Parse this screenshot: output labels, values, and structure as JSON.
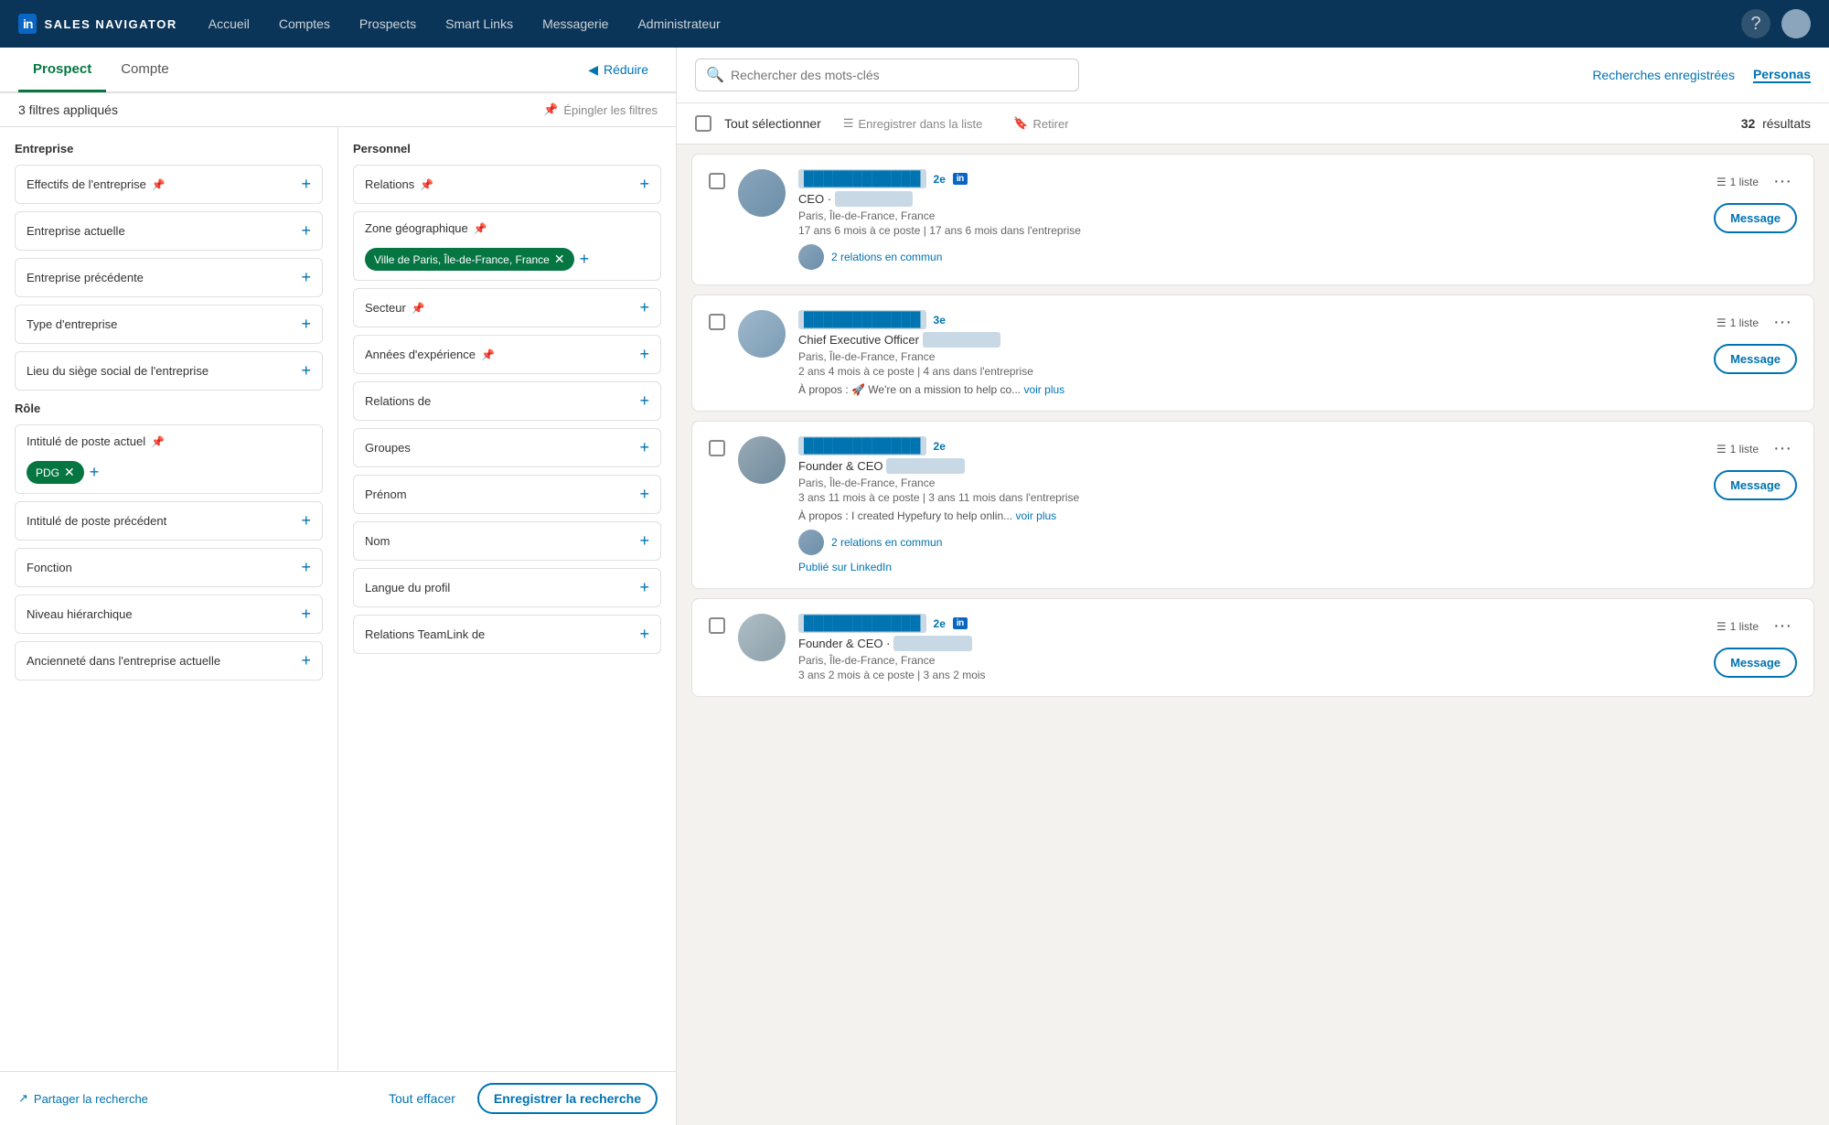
{
  "nav": {
    "logo_text": "in",
    "brand": "SALES NAVIGATOR",
    "items": [
      "Accueil",
      "Comptes",
      "Prospects",
      "Smart Links",
      "Messagerie",
      "Administrateur"
    ]
  },
  "tabs": {
    "prospect_label": "Prospect",
    "compte_label": "Compte",
    "reduce_label": "Réduire"
  },
  "filters": {
    "applied_label": "3 filtres appliqués",
    "pin_label": "Épingler les filtres",
    "entreprise_title": "Entreprise",
    "role_title": "Rôle",
    "personnel_title": "Personnel",
    "entreprise_items": [
      "Effectifs de l'entreprise",
      "Entreprise actuelle",
      "Entreprise précédente",
      "Type d'entreprise",
      "Lieu du siège social de l'entreprise"
    ],
    "role_items": [
      "Intitulé de poste actuel",
      "Intitulé de poste précédent",
      "Fonction",
      "Niveau hiérarchique",
      "Ancienneté dans l'entreprise actuelle"
    ],
    "role_tag": "PDG",
    "personnel_items": [
      "Relations",
      "Zone géographique",
      "Secteur",
      "Années d'expérience",
      "Relations de",
      "Groupes",
      "Prénom",
      "Nom",
      "Langue du profil",
      "Relations TeamLink de"
    ],
    "geo_tag": "Ville de Paris, Île-de-France, France"
  },
  "bottom": {
    "share_label": "Partager la recherche",
    "clear_label": "Tout effacer",
    "save_label": "Enregistrer la recherche"
  },
  "search": {
    "placeholder": "Rechercher des mots-clés",
    "saved_label": "Recherches enregistrées",
    "personas_label": "Personas"
  },
  "toolbar": {
    "select_all_label": "Tout sélectionner",
    "save_list_label": "Enregistrer dans la liste",
    "retire_label": "Retirer",
    "results_count": "32",
    "results_label": "résultats"
  },
  "results": [
    {
      "name_blurred": true,
      "degree": "2e",
      "has_li_badge": true,
      "title": "CEO",
      "company_blurred": true,
      "location": "Paris, Île-de-France, France",
      "tenure": "17 ans 6 mois à ce poste | 17 ans 6 mois dans l'entreprise",
      "relations_count": "2 relations en commun",
      "has_about": false,
      "has_linkedin_published": false,
      "liste_label": "1 liste"
    },
    {
      "name_blurred": true,
      "degree": "3e",
      "has_li_badge": false,
      "title": "Chief Executive Officer",
      "company_blurred": true,
      "location": "Paris, Île-de-France, France",
      "tenure": "2 ans 4 mois à ce poste | 4 ans dans l'entreprise",
      "relations_count": null,
      "has_about": true,
      "about_text": "À propos : 🚀 We're on a mission to help co...",
      "voir_plus": "voir plus",
      "has_linkedin_published": false,
      "liste_label": "1 liste"
    },
    {
      "name_blurred": true,
      "degree": "2e",
      "has_li_badge": false,
      "title": "Founder & CEO",
      "company_blurred": true,
      "location": "Paris, Île-de-France, France",
      "tenure": "3 ans 11 mois à ce poste | 3 ans 11 mois dans l'entreprise",
      "relations_count": "2 relations en commun",
      "has_about": true,
      "about_text": "À propos : I created Hypefury to help onlin...",
      "voir_plus": "voir plus",
      "has_linkedin_published": true,
      "published_label": "Publié sur LinkedIn",
      "liste_label": "1 liste"
    },
    {
      "name_blurred": true,
      "degree": "2e",
      "has_li_badge": true,
      "title": "Founder & CEO",
      "company_blurred": true,
      "location": "Paris, Île-de-France, France",
      "tenure": "3 ans 2 mois à ce poste | 3 ans 2 mois",
      "relations_count": null,
      "has_about": false,
      "has_linkedin_published": false,
      "liste_label": "1 liste"
    }
  ]
}
